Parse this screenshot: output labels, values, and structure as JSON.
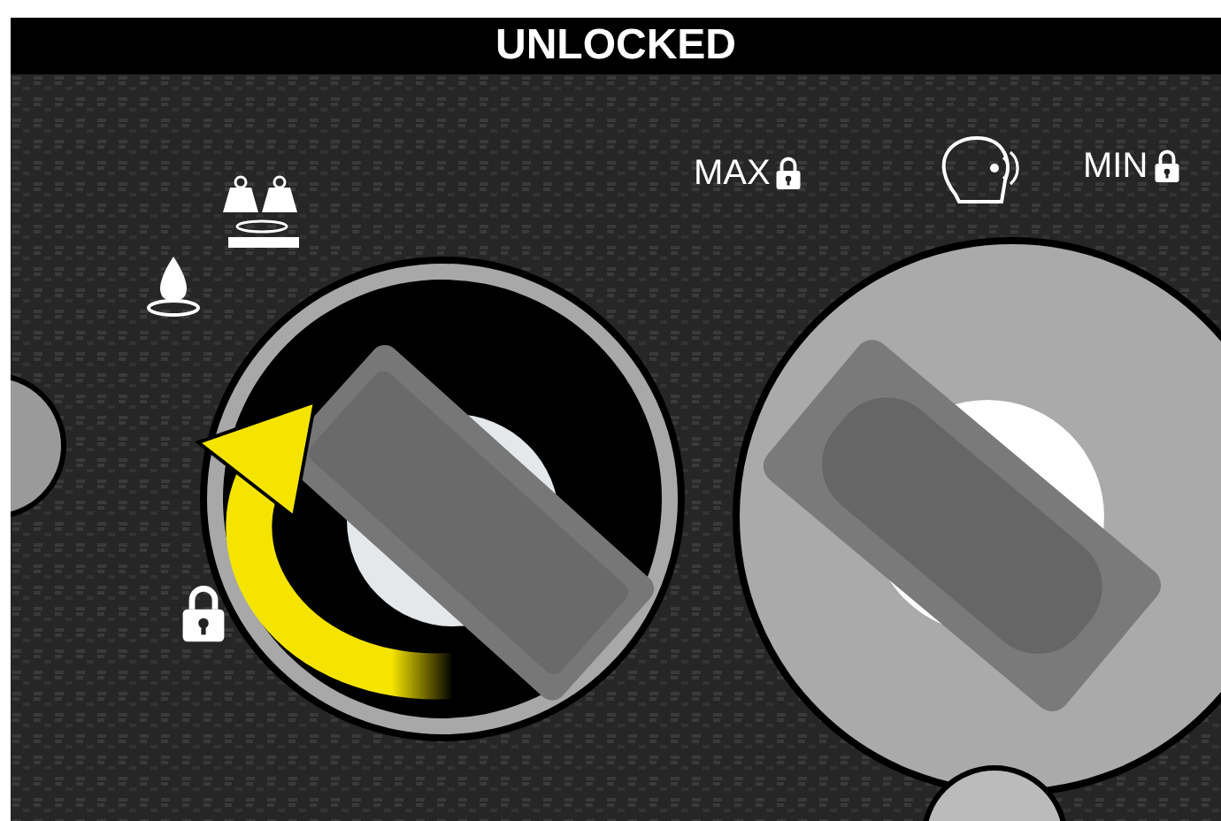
{
  "header": {
    "title": "UNLOCKED"
  },
  "labels": [
    {
      "text": "MAX"
    },
    {
      "text": "MIN"
    }
  ]
}
